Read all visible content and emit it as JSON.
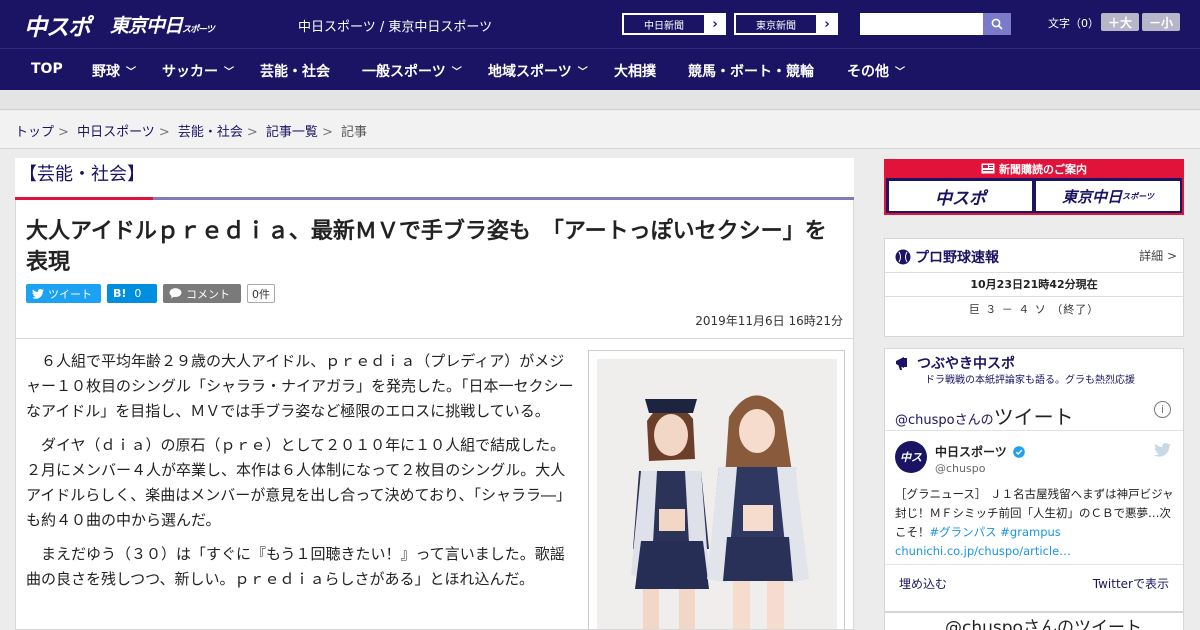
{
  "header": {
    "logo_main": "中スポ",
    "logo_tokyo": "東京中日",
    "logo_tokyo_sub": "スポーツ",
    "site_title": "中日スポーツ / 東京中日スポーツ",
    "ext_links": [
      "中日新聞",
      "東京新聞"
    ],
    "font_label": "文字（0）",
    "font_larger": "＋大",
    "font_smaller": "－小"
  },
  "nav": [
    {
      "label": "TOP",
      "dropdown": false
    },
    {
      "label": "野球",
      "dropdown": true
    },
    {
      "label": "サッカー",
      "dropdown": true
    },
    {
      "label": "芸能・社会",
      "dropdown": false
    },
    {
      "label": "一般スポーツ",
      "dropdown": true
    },
    {
      "label": "地域スポーツ",
      "dropdown": true
    },
    {
      "label": "大相撲",
      "dropdown": false
    },
    {
      "label": "競馬・ボート・競輪",
      "dropdown": false
    },
    {
      "label": "その他",
      "dropdown": true
    }
  ],
  "breadcrumb": [
    "トップ",
    "中日スポーツ",
    "芸能・社会",
    "記事一覧",
    "記事"
  ],
  "article": {
    "section": "【芸能・社会】",
    "headline": "大人アイドルｐｒｅｄｉａ、最新ＭＶで手ブラ姿も　「アートっぽいセクシー」を表現",
    "share": {
      "tweet": "ツイート",
      "hatena_label": "B!",
      "hatena_count": "0",
      "comment": "コメント",
      "comment_count": "0件"
    },
    "date": "2019年11月6日 16時21分",
    "paragraphs": [
      "６人組で平均年齢２９歳の大人アイドル、ｐｒｅｄｉａ（プレディア）がメジャー１０枚目のシングル「シャララ・ナイアガラ」を発売した。「日本一セクシーなアイドル」を目指し、ＭＶでは手ブラ姿など極限のエロスに挑戦している。",
      "ダイヤ（ｄｉａ）の原石（ｐｒｅ）として２０１０年に１０人組で結成した。２月にメンバー４人が卒業し、本作は６人体制になって２枚目のシングル。大人アイドルらしく、楽曲はメンバーが意見を出し合って決めており、「シャララ―」も約４０曲の中から選んだ。",
      "まえだゆう（３０）は「すぐに『もう１回聴きたい！』って言いました。歌謡曲の良さを残しつつ、新しい。ｐｒｅｄｉａらしさがある」とほれ込んだ。"
    ]
  },
  "sidebar": {
    "subscription_banner": "新聞購読のご案内",
    "sub_logo_1": "中スポ",
    "sub_logo_2": "東京中日",
    "sub_logo_2_sub": "スポーツ",
    "baseball": {
      "title": "プロ野球速報",
      "more": "詳細 >",
      "updated": "10月23日21時42分現在",
      "score": "巨 ３ － ４ ソ （終了）"
    },
    "twitter": {
      "title": "つぶやき中スポ",
      "subtitle": "ドラ戦戦の本紙評論家も語る。グラも熱烈応援",
      "handle_link": "@chuspo",
      "handle_suffix": "さんの",
      "tweets_label": "ツイート",
      "avatar_text": "中ス",
      "user_name": "中日スポーツ",
      "user_handle": "@chuspo",
      "tweet_text": "［グラニュース］ Ｊ１名古屋残留へまずは神戸ビジャ封じ！ＭＦシミッチ前回「人生初」のＣＢで悪夢…次こそ！",
      "tweet_hashtags": "#グランパス #grampus",
      "tweet_link": "chunichi.co.jp/chuspo/article…",
      "embed": "埋め込む",
      "view_on_twitter": "Twitterで表示",
      "next_heading": "@chuspoさんのツイート"
    }
  },
  "colors": {
    "navy": "#1b1464",
    "red": "#e2133a",
    "accent_line": "#7f7bb8",
    "twitter": "#1da1f2"
  }
}
